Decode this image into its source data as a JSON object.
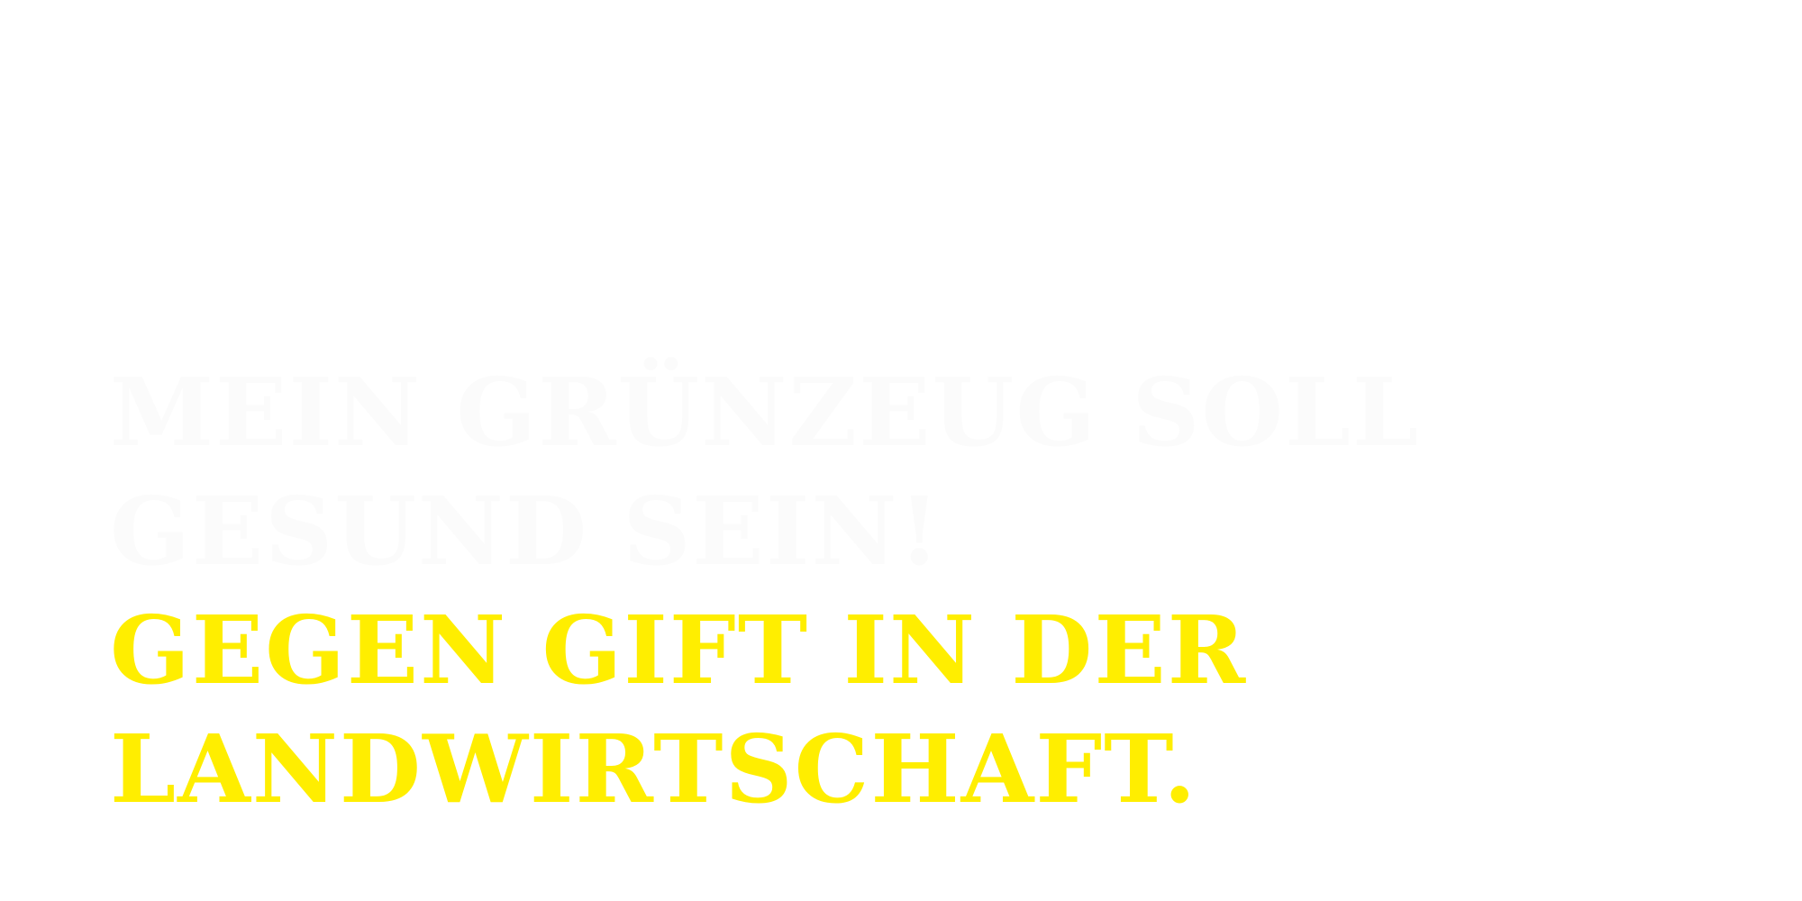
{
  "headline": {
    "line1": "MEIN GRÜNZEUG SOLL",
    "line2": "GESUND SEIN!",
    "line3": "GEGEN GIFT IN DER",
    "line4": "LANDWIRTSCHAFT."
  },
  "colors": {
    "background": "#ffffff",
    "faint_text": "#fbfbfb",
    "accent": "#ffee00"
  }
}
